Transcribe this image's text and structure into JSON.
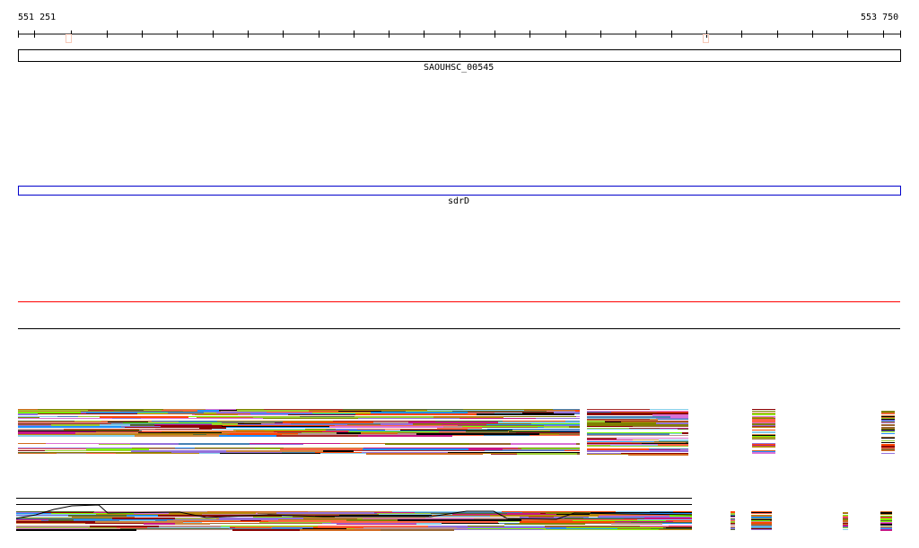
{
  "ruler": {
    "start_label": "551 251",
    "end_label": "553 750"
  },
  "tracks": [
    {
      "name": "SAOUHSC_00545",
      "border_color": "#000000"
    },
    {
      "name": "sdrD",
      "border_color": "#0000cc"
    }
  ],
  "colors": {
    "marker": "#f6c9b8",
    "red_line": "#ff0000",
    "palette": [
      "#808000",
      "#ff6347",
      "#000000",
      "#9acd32",
      "#c71585",
      "#d2691e",
      "#87ceeb",
      "#8b0000",
      "#b8860b",
      "#da70d6",
      "#4682b4",
      "#7cfc00",
      "#cd853f",
      "#a52a2a",
      "#ff4500",
      "#9370db",
      "#bc8f8f",
      "#556b2f",
      "#1e90ff",
      "#996633"
    ]
  }
}
